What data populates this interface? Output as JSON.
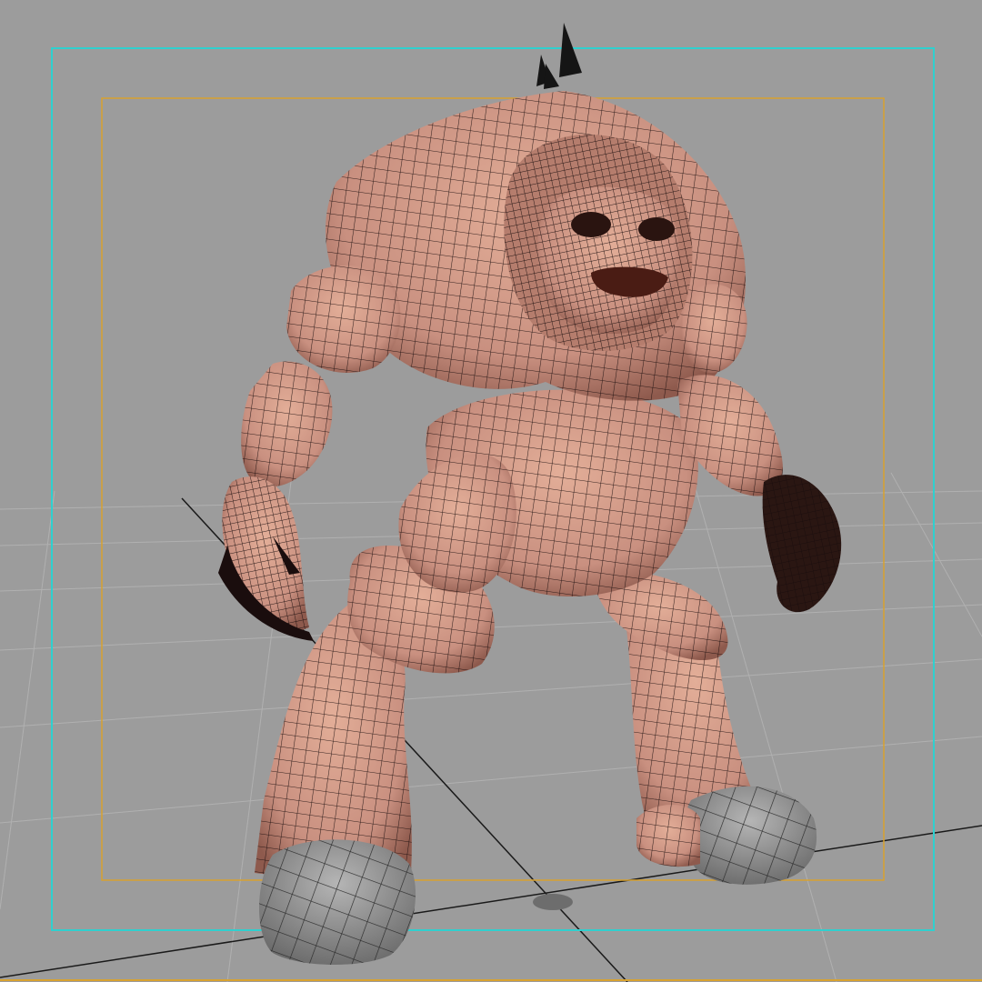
{
  "viewport": {
    "background": "#9c9c9c",
    "grid_color": "#b3b3b3",
    "axis_color": "#1a1a1a",
    "safe_action_color": "#2fd0cf",
    "safe_title_color": "#d8a22f",
    "skin_color": "#d7a08c",
    "skin_shadow_color": "#a56e5f",
    "wire_color": "#1a0d0d",
    "hoof_color": "#8f8f8f"
  },
  "model": {
    "icon": "creature-wireframe-mesh",
    "shading": "wireframe-on-shaded"
  }
}
